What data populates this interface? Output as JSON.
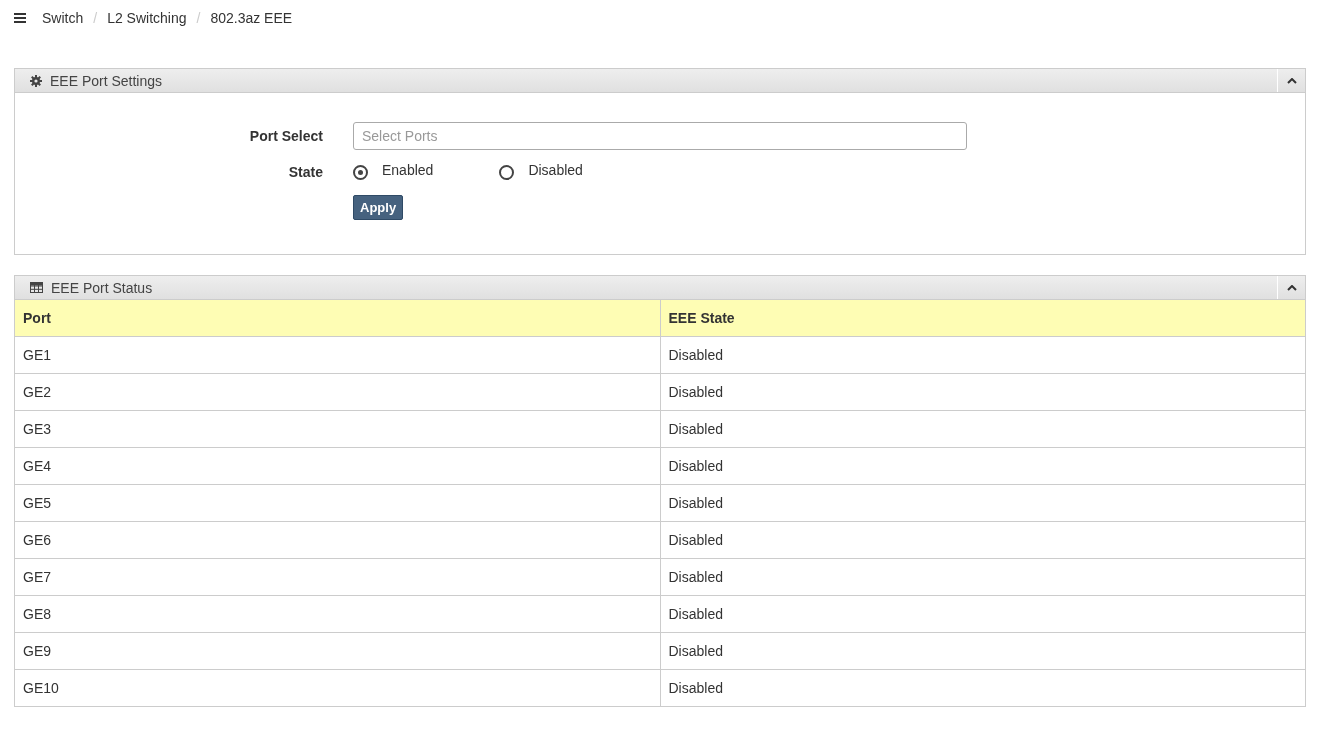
{
  "breadcrumb": [
    "Switch",
    "L2 Switching",
    "802.3az EEE"
  ],
  "breadcrumb_separator": "/",
  "settings_panel": {
    "title": "EEE Port Settings",
    "port_select": {
      "label": "Port Select",
      "placeholder": "Select Ports"
    },
    "state": {
      "label": "State",
      "options": [
        {
          "label": "Enabled",
          "selected": true
        },
        {
          "label": "Disabled",
          "selected": false
        }
      ]
    },
    "apply_button": "Apply"
  },
  "status_panel": {
    "title": "EEE Port Status",
    "table": {
      "columns": [
        "Port",
        "EEE State"
      ],
      "rows": [
        [
          "GE1",
          "Disabled"
        ],
        [
          "GE2",
          "Disabled"
        ],
        [
          "GE3",
          "Disabled"
        ],
        [
          "GE4",
          "Disabled"
        ],
        [
          "GE5",
          "Disabled"
        ],
        [
          "GE6",
          "Disabled"
        ],
        [
          "GE7",
          "Disabled"
        ],
        [
          "GE8",
          "Disabled"
        ],
        [
          "GE9",
          "Disabled"
        ],
        [
          "GE10",
          "Disabled"
        ]
      ]
    }
  }
}
